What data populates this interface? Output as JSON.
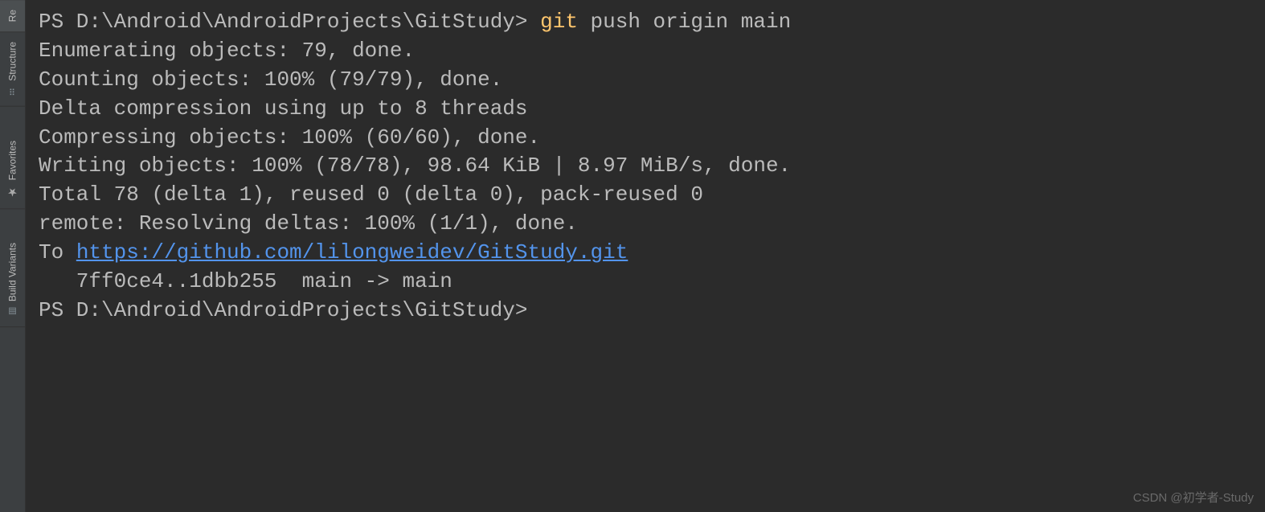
{
  "sidebar": {
    "tabs": [
      {
        "label": "Re"
      },
      {
        "label": "Structure"
      },
      {
        "label": "Favorites"
      },
      {
        "label": "Build Variants"
      }
    ]
  },
  "terminal": {
    "prompt1_path": "PS D:\\Android\\AndroidProjects\\GitStudy> ",
    "cmd_git": "git",
    "cmd_rest": " push origin main",
    "lines": {
      "l1": "Enumerating objects: 79, done.",
      "l2": "Counting objects: 100% (79/79), done.",
      "l3": "Delta compression using up to 8 threads",
      "l4": "Compressing objects: 100% (60/60), done.",
      "l5": "Writing objects: 100% (78/78), 98.64 KiB | 8.97 MiB/s, done.",
      "l6": "Total 78 (delta 1), reused 0 (delta 0), pack-reused 0",
      "l7": "remote: Resolving deltas: 100% (1/1), done.",
      "l8_prefix": "To ",
      "l8_link": "https://github.com/lilongweidev/GitStudy.git",
      "l9": "   7ff0ce4..1dbb255  main -> main"
    },
    "prompt2": "PS D:\\Android\\AndroidProjects\\GitStudy>"
  },
  "watermark": "CSDN @初学者-Study"
}
